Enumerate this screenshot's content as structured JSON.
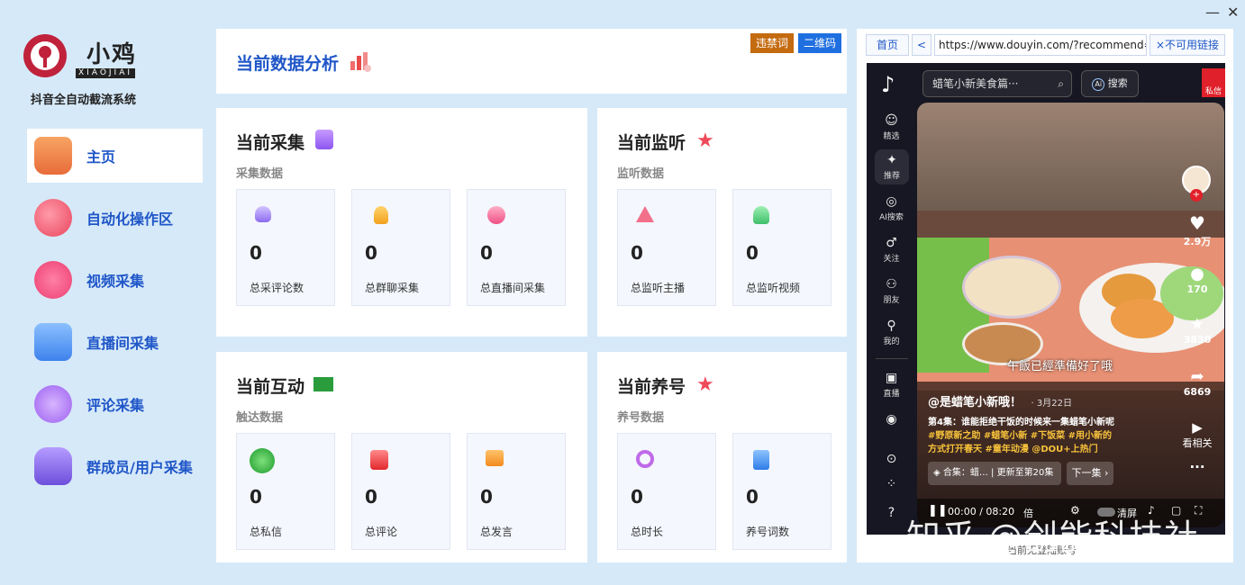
{
  "window": {
    "minimize": "—",
    "close": "✕"
  },
  "brand": {
    "name": "小鸡",
    "sub": "XIAOJIAI",
    "tagline": "抖音全自动截流系统"
  },
  "nav": [
    {
      "label": "主页",
      "color": "#f08a4b"
    },
    {
      "label": "自动化操作区",
      "color": "#ee5b6f"
    },
    {
      "label": "视频采集",
      "color": "#f24c7c"
    },
    {
      "label": "直播间采集",
      "color": "#4a8df0"
    },
    {
      "label": "评论采集",
      "color": "#a56bf0"
    },
    {
      "label": "群成员/用户采集",
      "color": "#7a5be0"
    }
  ],
  "header": {
    "title": "当前数据分析",
    "btn_banned": "违禁词",
    "btn_qrcode": "二维码"
  },
  "sections": {
    "collect": {
      "title": "当前采集",
      "sub": "采集数据",
      "stats": [
        {
          "value": "0",
          "label": "总采评论数"
        },
        {
          "value": "0",
          "label": "总群聊采集"
        },
        {
          "value": "0",
          "label": "总直播间采集"
        }
      ]
    },
    "monitor": {
      "title": "当前监听",
      "sub": "监听数据",
      "stats": [
        {
          "value": "0",
          "label": "总监听主播"
        },
        {
          "value": "0",
          "label": "总监听视频"
        }
      ]
    },
    "interact": {
      "title": "当前互动",
      "sub": "触达数据",
      "stats": [
        {
          "value": "0",
          "label": "总私信"
        },
        {
          "value": "0",
          "label": "总评论"
        },
        {
          "value": "0",
          "label": "总发言"
        }
      ]
    },
    "raise": {
      "title": "当前养号",
      "sub": "养号数据",
      "stats": [
        {
          "value": "0",
          "label": "总时长"
        },
        {
          "value": "0",
          "label": "养号词数"
        }
      ]
    }
  },
  "browser": {
    "home": "首页",
    "back": "<",
    "url": "https://www.douyin.com/?recommend=1",
    "no_link": "×不可用链接",
    "status": "当前无登陆账号"
  },
  "douyin": {
    "search_placeholder": "蜡笔小新美食篇···",
    "ai_search": "搜索",
    "dm": "私信",
    "side": [
      {
        "icon": "featured",
        "label": "精选"
      },
      {
        "icon": "recommend",
        "label": "推荐"
      },
      {
        "icon": "ai",
        "label": "AI搜索"
      },
      {
        "icon": "follow",
        "label": "关注"
      },
      {
        "icon": "friends",
        "label": "朋友"
      },
      {
        "icon": "me",
        "label": "我的"
      },
      {
        "icon": "live",
        "label": "直播"
      },
      {
        "icon": "game",
        "label": ""
      }
    ],
    "likes": "2.9万",
    "comments": "170",
    "favorites": "3830",
    "shares": "6869",
    "related": "看相关",
    "subtitle": "午飯已經準備好了哦",
    "author": "@是蜡笔小新哦！",
    "date": "· 3月22日",
    "desc1": "第4集：谁能拒绝干饭的时候来一集蜡笔小新呢",
    "desc2": "#野原新之助 #蜡笔小新 #下饭菜 #用小新的",
    "desc3": "方式打开春天 #童年动漫 @DOU+上热门",
    "collection": "合集：蜡…  | 更新至第20集",
    "next": "下一集 ›",
    "time": "00:00 / 08:20",
    "speed": "倍",
    "clear": "清屏"
  },
  "watermark": "知乎 @创能科技社"
}
